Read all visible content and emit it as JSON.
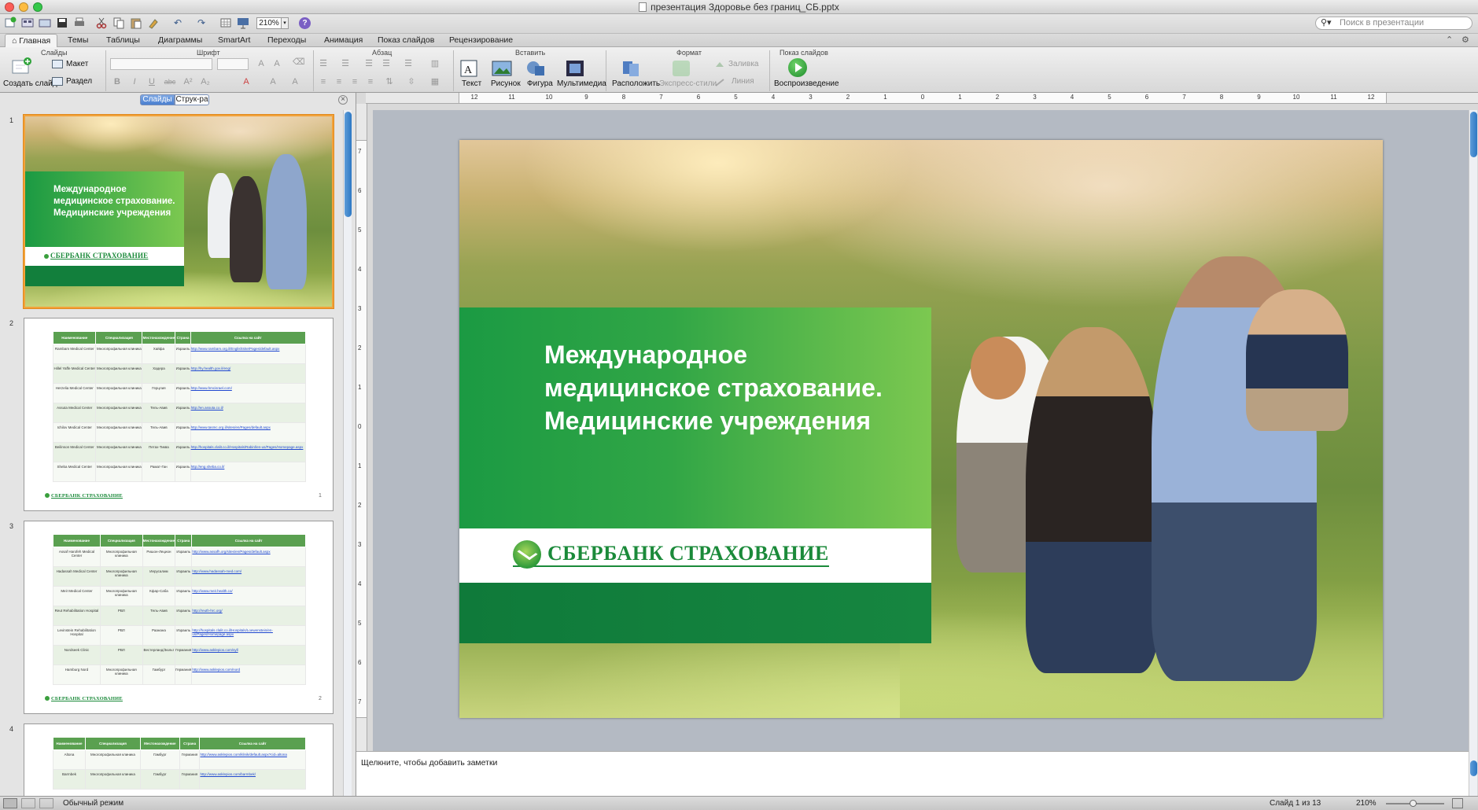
{
  "window": {
    "title": "презентация Здоровье без границ_СБ.pptx"
  },
  "toolbar": {
    "zoom": "210%",
    "zoom_arrow": "▾",
    "help": "?",
    "search_placeholder": "Поиск в презентации",
    "icons": [
      "new-slide-icon",
      "gallery-icon",
      "open-icon",
      "save-icon",
      "print-icon",
      "cut-icon",
      "copy-icon",
      "paste-icon",
      "format-icon",
      "undo-icon",
      "redo-icon",
      "table-icon",
      "slideshow-icon"
    ],
    "undo_glyph": "↶",
    "redo_glyph": "↷"
  },
  "ribbon_tabs": [
    "Главная",
    "Темы",
    "Таблицы",
    "Диаграммы",
    "SmartArt",
    "Переходы",
    "Анимация",
    "Показ слайдов",
    "Рецензирование"
  ],
  "ribbon_controls": {
    "collapse": "⌃",
    "settings": "⚙"
  },
  "ribbon": {
    "groups": {
      "slides": "Слайды",
      "font": "Шрифт",
      "paragraph": "Абзац",
      "insert": "Вставить",
      "format": "Формат",
      "slideshow": "Показ слайдов"
    },
    "buttons": {
      "new_slide": "Создать слайд",
      "layout": "Макет",
      "section": "Раздел",
      "text": "Текст",
      "picture": "Рисунок",
      "shape": "Фигура",
      "media": "Мультимедиа",
      "arrange": "Расположить",
      "quick_styles": "Экспресс-стили",
      "fill": "Заливка",
      "line": "Линия",
      "play": "Воспроизведение"
    },
    "font_buttons": [
      "B",
      "I",
      "U",
      "abc",
      "A²",
      "A₂"
    ]
  },
  "panel": {
    "tab_slides": "Слайды",
    "tab_outline": "Струк-ра",
    "close_glyph": "×",
    "slide_numbers": [
      "1",
      "2",
      "3",
      "4"
    ]
  },
  "thumb_table": {
    "headers": [
      "Наименование",
      "Специализация",
      "Местонахождение",
      "Страна",
      "Ссылка на сайт"
    ],
    "slide2": [
      [
        "Rambam Medical Center",
        "Многопрофильная клиника",
        "Хайфа",
        "Израиль",
        "http://www.rambam.org.il/EnglishSite/Pages/default.aspx"
      ],
      [
        "Hillel Yaffe Medical Center",
        "Многопрофильная клиника",
        "Хадера",
        "Израиль",
        "http://hy.health.gov.il/eng/"
      ],
      [
        "Herzelia Medical Center",
        "Многопрофильная клиника",
        "Герцлия",
        "Израиль",
        "http://www.hmcisrael.com/"
      ],
      [
        "Assuta Medical Center",
        "Многопрофильная клиника",
        "Тель-Авив",
        "Израиль",
        "http://en.assuta.co.il/"
      ],
      [
        "Ichilov Medical Center",
        "Многопрофильная клиника",
        "Тель-Авив",
        "Израиль",
        "http://www.tasmc.org.il/sites/en/Pages/default.aspx"
      ],
      [
        "Beilinson Medical Center",
        "Многопрофильная клиника",
        "Петах-Тиква",
        "Израиль",
        "http://hospitals.clalit.co.il/Hospitals/Rabinl/en-us/Pages/Homepage.aspx"
      ],
      [
        "Sheba Medical Center",
        "Многопрофильная клиника",
        "Рамат-Ган",
        "Израиль",
        "http://eng.sheba.co.il/"
      ]
    ],
    "slide3": [
      [
        "Assaf Harofeh Medical Center",
        "Многопрофильная клиника",
        "Ришон-Лецион",
        "Израиль",
        "http://www.assafh.org/sites/en/Pages/default.aspx"
      ],
      [
        "Hadassah Medical Center",
        "Многопрофильная клиника",
        "Иерусалим",
        "Израиль",
        "http://www.hadassah-med.com/"
      ],
      [
        "Meir Medical Center",
        "Многопрофильная клиника",
        "Кфар-Саба",
        "Израиль",
        "http://www.meir.health.co/"
      ],
      [
        "Reut Rehabilitation Hospital",
        "РВЛ",
        "Тель-Авив",
        "Израиль",
        "http://reuth-hrc.org/"
      ],
      [
        "Levinstein Rehabilitation Hospital",
        "РВЛ",
        "Раанана",
        "Израиль",
        "http://hospitals.clalit.co.il/Hospitals/Loewenstein/en-us/Pages/Homepage.aspx"
      ],
      [
        "Nordseek Clinic",
        "РВЛ",
        "Вестерланд/Зюльт",
        "Германия",
        "http://www.asklepios.com/syll"
      ],
      [
        "Hamburg Nord",
        "Многопрофильная клиника",
        "Гамбург",
        "Германия",
        "http://www.asklepios.com/nord"
      ]
    ],
    "slide4": [
      [
        "Altona",
        "Многопрофильная клиника",
        "Гамбург",
        "Германия",
        "http://www.asklepios.com/klinik/default.aspx?cid=altona"
      ],
      [
        "Barmbek",
        "Многопрофильная клиника",
        "Гамбург",
        "Германия",
        "http://www.asklepios.com/barmbek/"
      ]
    ],
    "page2": "1",
    "page3": "2"
  },
  "slide": {
    "title_lines": [
      "Международное",
      "медицинское страхование.",
      "Медицинские учреждения"
    ],
    "logo": "СБЕРБАНК СТРАХОВАНИЕ"
  },
  "rulers": {
    "h_ticks": [
      "12",
      "11",
      "10",
      "9",
      "8",
      "7",
      "6",
      "5",
      "4",
      "3",
      "2",
      "1",
      "0",
      "1",
      "2",
      "3",
      "4",
      "5",
      "6",
      "7",
      "8",
      "9",
      "10",
      "11",
      "12"
    ],
    "v_ticks": [
      "7",
      "6",
      "5",
      "4",
      "3",
      "2",
      "1",
      "0",
      "1",
      "2",
      "3",
      "4",
      "5",
      "6",
      "7"
    ]
  },
  "notes": {
    "placeholder": "Щелкните, чтобы добавить заметки"
  },
  "status": {
    "view_mode": "Обычный режим",
    "slide_counter": "Слайд 1 из 13",
    "zoom": "210%"
  },
  "colors": {
    "accent_green": "#1b9a43",
    "logo_green": "#1b8a3a",
    "selection_orange": "#f2a23a",
    "scroll_blue": "#2d78c4"
  }
}
